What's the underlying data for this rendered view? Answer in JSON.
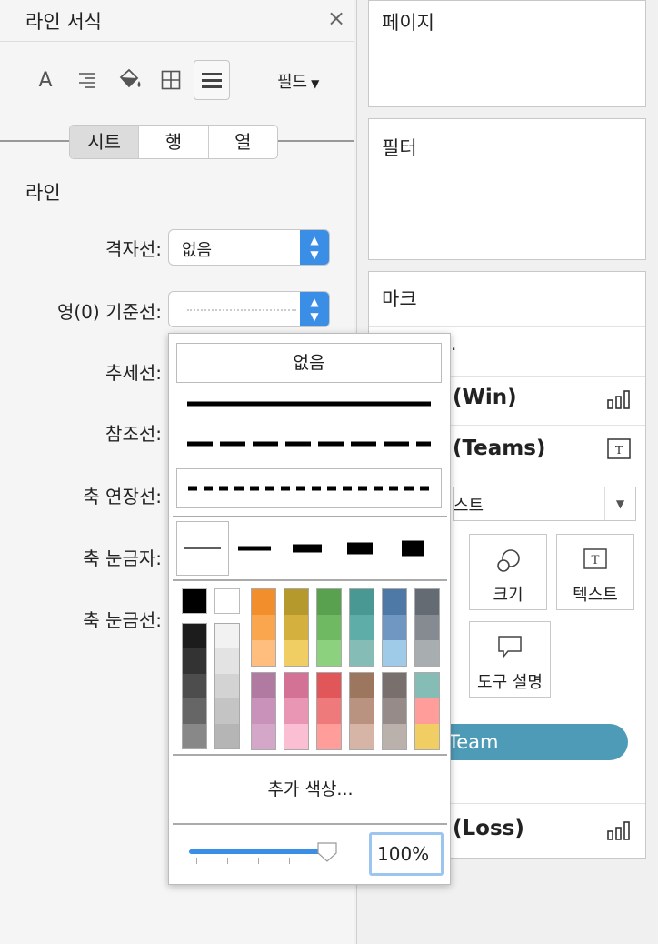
{
  "format_panel": {
    "title": "라인 서식",
    "close": "×",
    "field_dropdown": "필드",
    "segments": [
      "시트",
      "행",
      "열"
    ],
    "active_segment": "시트",
    "section": "라인",
    "rows": [
      {
        "label": "격자선:",
        "value": "없음"
      },
      {
        "label": "영(0) 기준선:",
        "value": ""
      },
      {
        "label": "추세선:"
      },
      {
        "label": "참조선:"
      },
      {
        "label": "축 연장선:"
      },
      {
        "label": "축 눈금자:"
      },
      {
        "label": "축 눈금선:"
      }
    ]
  },
  "shelves": {
    "pages": "페이지",
    "filters": "필터",
    "marks": "마크",
    "marks_partial_row": ".",
    "field1": "(Win)",
    "field2": "(Teams)",
    "mark_type_partial": "스트",
    "mark_buttons": {
      "size": "크기",
      "text": "텍스트",
      "tooltip": "도구 설명"
    },
    "team_pill": "Team",
    "field3": "(Loss)"
  },
  "popup": {
    "none_option": "없음",
    "more_colors": "추가 색상...",
    "opacity": "100%",
    "opacity_fraction": 1.0,
    "palette": {
      "basic": [
        "#000000",
        "#ffffff"
      ],
      "grays_dark": [
        "#1c1c1c",
        "#333333",
        "#4d4d4d",
        "#666666",
        "#888888"
      ],
      "grays_light": [
        "#f2f2f2",
        "#e3e3e3",
        "#d3d3d3",
        "#c4c4c4",
        "#b5b5b5"
      ],
      "top_columns": [
        [
          "#f28e2b",
          "#f9a64e",
          "#ffbe7d"
        ],
        [
          "#b6992d",
          "#d4b13f",
          "#f1ce63"
        ],
        [
          "#59a14f",
          "#6fb963",
          "#8cd17d"
        ],
        [
          "#499894",
          "#5fada8",
          "#86bcb6"
        ],
        [
          "#4e79a7",
          "#6f97c2",
          "#a0cbe8"
        ],
        [
          "#646b73",
          "#858b91",
          "#a8adb0"
        ]
      ],
      "bottom_columns": [
        [
          "#b07aa1",
          "#c892bb",
          "#d4a6c8"
        ],
        [
          "#d37295",
          "#e896b3",
          "#fabfd2"
        ],
        [
          "#e15759",
          "#ee7a7b",
          "#ff9d9a"
        ],
        [
          "#9d7660",
          "#b99280",
          "#d7b5a6"
        ],
        [
          "#79706e",
          "#968b88",
          "#bab0ac"
        ],
        [
          "#86bcb6",
          "#ff9d9a",
          "#f1ce63"
        ]
      ]
    }
  },
  "colors": {
    "accent": "#3a8ee6",
    "pill": "#4e9bb7"
  }
}
